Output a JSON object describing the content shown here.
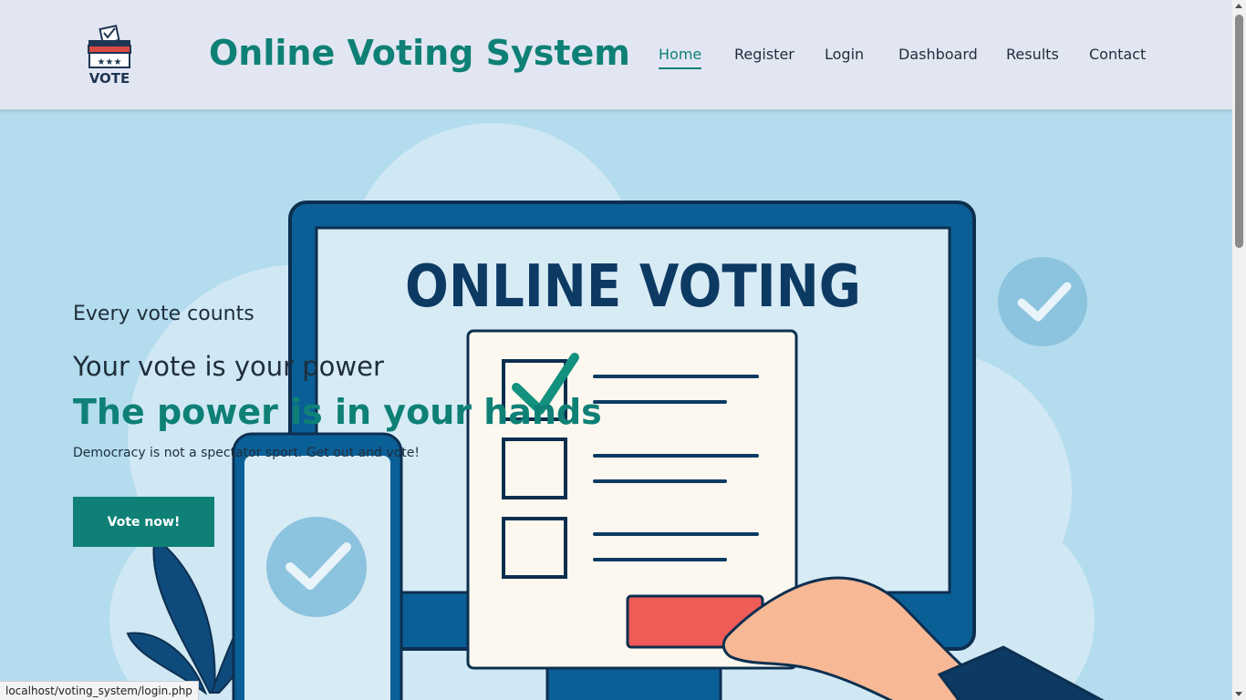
{
  "header": {
    "logo_text": "VOTE",
    "site_title": "Online Voting System"
  },
  "nav": {
    "items": [
      {
        "label": "Home",
        "active": true
      },
      {
        "label": "Register",
        "active": false
      },
      {
        "label": "Login",
        "active": false
      },
      {
        "label": "Dashboard",
        "active": false
      },
      {
        "label": "Results",
        "active": false
      },
      {
        "label": "Contact",
        "active": false
      }
    ]
  },
  "hero": {
    "art_heading": "ONLINE VOTING",
    "tagline_small": "Every vote counts",
    "tagline_mid": "Your vote is your power",
    "tagline_big": "The power is in your hands",
    "quote": "Democracy is not a spectator sport. Get out and vote!",
    "button_label": "Vote now!"
  },
  "status_bar": {
    "url": "localhost/voting_system/login.php"
  },
  "colors": {
    "accent": "#0e8076",
    "header_bg": "#e2e6f2",
    "hero_bg": "#b3dcee",
    "monitor_blue": "#0b5f97",
    "submit_red": "#ef5b57"
  }
}
